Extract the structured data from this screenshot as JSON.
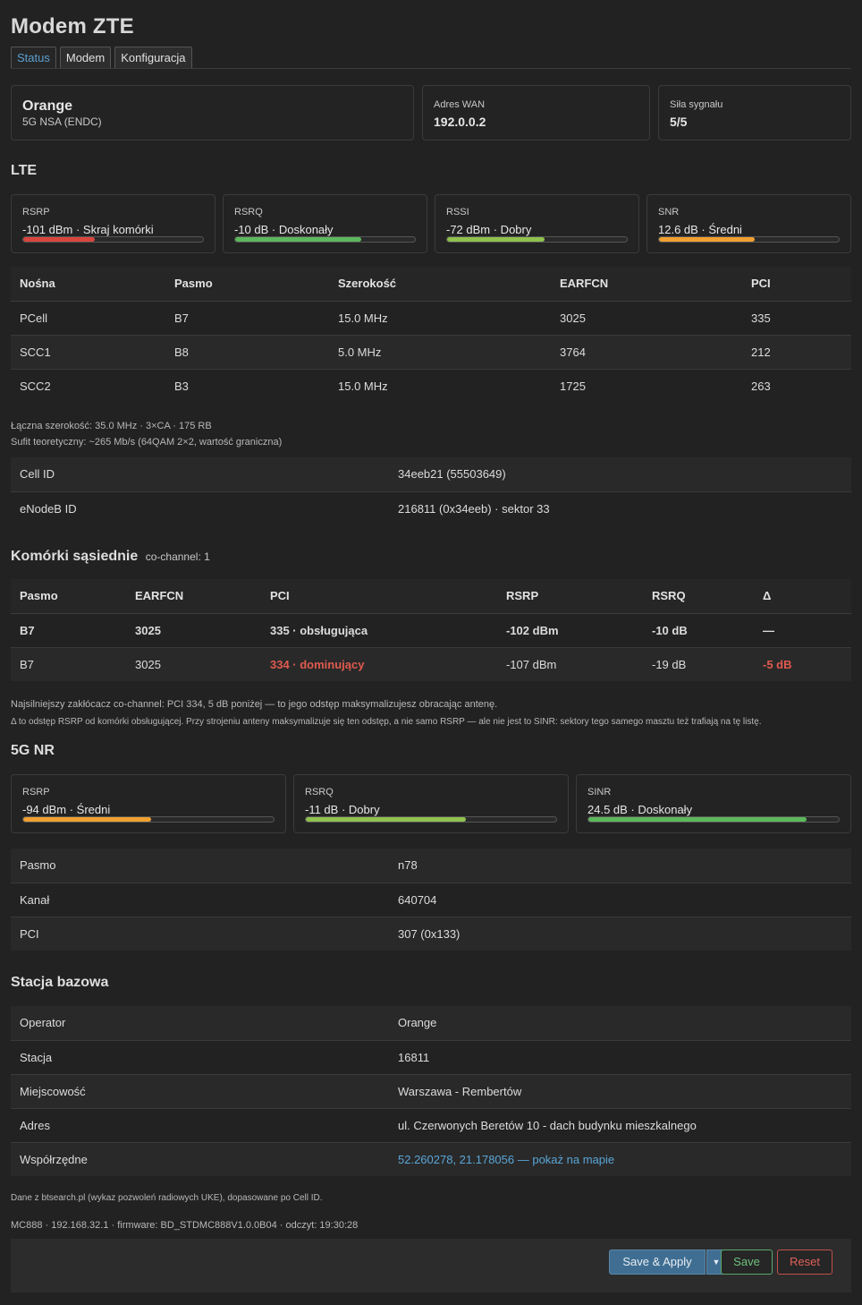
{
  "title": "Modem ZTE",
  "tabs": [
    "Status",
    "Modem",
    "Konfiguracja"
  ],
  "summary": {
    "operator": "Orange",
    "mode": "5G NSA (ENDC)",
    "wan_label": "Adres WAN",
    "wan_value": "192.0.0.2",
    "signal_label": "Siła sygnału",
    "signal_value": "5/5"
  },
  "lte": {
    "heading": "LTE",
    "meters": [
      {
        "label": "RSRP",
        "value": "-101 dBm · Skraj komórki",
        "level": 0.4,
        "color": "#d9453d"
      },
      {
        "label": "RSRQ",
        "value": "-10 dB · Doskonały",
        "level": 0.7,
        "color": "#5cb85c"
      },
      {
        "label": "RSSI",
        "value": "-72 dBm · Dobry",
        "level": 0.54,
        "color": "#8fc24e"
      },
      {
        "label": "SNR",
        "value": "12.6 dB · Średni",
        "level": 0.53,
        "color": "#f0a030"
      }
    ],
    "carriers_headers": [
      "Nośna",
      "Pasmo",
      "Szerokość",
      "EARFCN",
      "PCI"
    ],
    "carriers": [
      [
        "PCell",
        "B7",
        "15.0 MHz",
        "3025",
        "335"
      ],
      [
        "SCC1",
        "B8",
        "5.0 MHz",
        "3764",
        "212"
      ],
      [
        "SCC2",
        "B3",
        "15.0 MHz",
        "1725",
        "263"
      ]
    ],
    "total_note": "Łączna szerokość: 35.0 MHz · 3×CA · 175 RB",
    "ceiling_note": "Sufit teoretyczny: ~265 Mb/s (64QAM 2×2, wartość graniczna)",
    "info": [
      [
        "Cell ID",
        "34eeb21 (55503649)"
      ],
      [
        "eNodeB ID",
        "216811 (0x34eeb) · sektor 33"
      ]
    ]
  },
  "neighbors": {
    "heading": "Komórki sąsiednie",
    "subheading": "co-channel: 1",
    "headers": [
      "Pasmo",
      "EARFCN",
      "PCI",
      "RSRP",
      "RSRQ",
      "Δ"
    ],
    "rows": [
      [
        "B7",
        "3025",
        "335 · obsługująca",
        "-102 dBm",
        "-10 dB",
        "—"
      ],
      [
        "B7",
        "3025",
        "334 · dominujący",
        "-107 dBm",
        "-19 dB",
        "-5 dB"
      ]
    ],
    "note1": "Najsilniejszy zakłócacz co-channel: PCI 334, 5 dB poniżej — to jego odstęp maksymalizujesz obracając antenę.",
    "note2": "Δ to odstęp RSRP od komórki obsługującej. Przy strojeniu anteny maksymalizuje się ten odstęp, a nie samo RSRP — ale nie jest to SINR: sektory tego samego masztu też trafiają na tę listę."
  },
  "nr": {
    "heading": "5G NR",
    "meters": [
      {
        "label": "RSRP",
        "value": "-94 dBm · Średni",
        "level": 0.51,
        "color": "#f0a030"
      },
      {
        "label": "RSRQ",
        "value": "-11 dB · Dobry",
        "level": 0.64,
        "color": "#8fc24e"
      },
      {
        "label": "SINR",
        "value": "24.5 dB · Doskonały",
        "level": 0.87,
        "color": "#5cb85c"
      }
    ],
    "info": [
      [
        "Pasmo",
        "n78"
      ],
      [
        "Kanał",
        "640704"
      ],
      [
        "PCI",
        "307 (0x133)"
      ]
    ]
  },
  "station": {
    "heading": "Stacja bazowa",
    "info": [
      [
        "Operator",
        "Orange"
      ],
      [
        "Stacja",
        "16811"
      ],
      [
        "Miejscowość",
        "Warszawa - Rembertów"
      ],
      [
        "Adres",
        "ul. Czerwonych Beretów 10 - dach budynku mieszkalnego"
      ]
    ],
    "coords_label": "Współrzędne",
    "coords_value": "52.260278, 21.178056 — pokaż na mapie",
    "source_note": "Dane z btsearch.pl (wykaz pozwoleń radiowych UKE), dopasowane po Cell ID."
  },
  "device_line": "MC888 · 192.168.32.1 · firmware: BD_STDMC888V1.0.0B04 · odczyt: 19:30:28",
  "buttons": {
    "apply": "Save & Apply",
    "save": "Save",
    "reset": "Reset"
  }
}
